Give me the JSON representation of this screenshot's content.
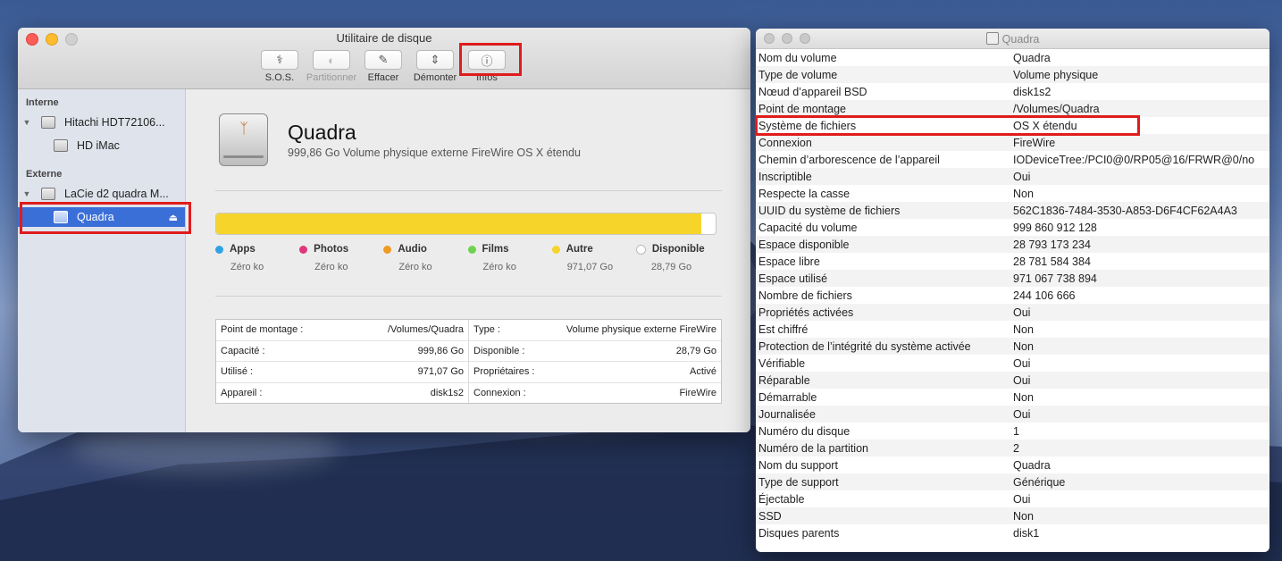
{
  "colors": {
    "bar_autre": "#f6d42a",
    "selection": "#3b6fd8",
    "highlight": "#e01c1c"
  },
  "du": {
    "title": "Utilitaire de disque",
    "toolbar": [
      {
        "label": "S.O.S.",
        "icon": "stethoscope-icon",
        "enabled": true
      },
      {
        "label": "Partitionner",
        "icon": "partition-icon",
        "enabled": false
      },
      {
        "label": "Effacer",
        "icon": "erase-icon",
        "enabled": true
      },
      {
        "label": "Démonter",
        "icon": "unmount-icon",
        "enabled": true
      },
      {
        "label": "Infos",
        "icon": "info-icon",
        "enabled": true
      }
    ],
    "sidebar": {
      "internal_label": "Interne",
      "external_label": "Externe",
      "items": [
        {
          "label": "Hitachi HDT72106..."
        },
        {
          "label": "HD iMac"
        },
        {
          "label": "LaCie d2 quadra M..."
        },
        {
          "label": "Quadra"
        }
      ]
    },
    "volume": {
      "name": "Quadra",
      "description": "999,86 Go Volume physique externe FireWire OS X étendu",
      "usage_fraction": 0.971
    },
    "legend": [
      {
        "label": "Apps",
        "value": "Zéro ko",
        "color": "#2fa3e6"
      },
      {
        "label": "Photos",
        "value": "Zéro ko",
        "color": "#e2367a"
      },
      {
        "label": "Audio",
        "value": "Zéro ko",
        "color": "#ef9a22"
      },
      {
        "label": "Films",
        "value": "Zéro ko",
        "color": "#6fd24f"
      },
      {
        "label": "Autre",
        "value": "971,07 Go",
        "color": "#f6d42a"
      },
      {
        "label": "Disponible",
        "value": "28,79 Go",
        "color": "#ffffff"
      }
    ],
    "props_left": [
      {
        "k": "Point de montage :",
        "v": "/Volumes/Quadra"
      },
      {
        "k": "Capacité :",
        "v": "999,86 Go"
      },
      {
        "k": "Utilisé :",
        "v": "971,07 Go"
      },
      {
        "k": "Appareil :",
        "v": "disk1s2"
      }
    ],
    "props_right": [
      {
        "k": "Type :",
        "v": "Volume physique externe FireWire"
      },
      {
        "k": "Disponible :",
        "v": "28,79 Go"
      },
      {
        "k": "Propriétaires :",
        "v": "Activé"
      },
      {
        "k": "Connexion :",
        "v": "FireWire"
      }
    ]
  },
  "info": {
    "title": "Quadra",
    "rows": [
      {
        "k": "Nom du volume",
        "v": "Quadra"
      },
      {
        "k": "Type de volume",
        "v": "Volume physique"
      },
      {
        "k": "Nœud d’appareil BSD",
        "v": "disk1s2"
      },
      {
        "k": "Point de montage",
        "v": "/Volumes/Quadra"
      },
      {
        "k": "Système de fichiers",
        "v": "OS X étendu"
      },
      {
        "k": "Connexion",
        "v": "FireWire"
      },
      {
        "k": "Chemin d’arborescence de l’appareil",
        "v": "IODeviceTree:/PCI0@0/RP05@16/FRWR@0/no"
      },
      {
        "k": "Inscriptible",
        "v": "Oui"
      },
      {
        "k": "Respecte la casse",
        "v": "Non"
      },
      {
        "k": "UUID du système de fichiers",
        "v": "562C1836-7484-3530-A853-D6F4CF62A4A3"
      },
      {
        "k": "Capacité du volume",
        "v": "999 860 912 128"
      },
      {
        "k": "Espace disponible",
        "v": "28 793 173 234"
      },
      {
        "k": "Espace libre",
        "v": "28 781 584 384"
      },
      {
        "k": "Espace utilisé",
        "v": "971 067 738 894"
      },
      {
        "k": "Nombre de fichiers",
        "v": "244 106 666"
      },
      {
        "k": "Propriétés activées",
        "v": "Oui"
      },
      {
        "k": "Est chiffré",
        "v": "Non"
      },
      {
        "k": "Protection de l’intégrité du système activée",
        "v": "Non"
      },
      {
        "k": "Vérifiable",
        "v": "Oui"
      },
      {
        "k": "Réparable",
        "v": "Oui"
      },
      {
        "k": "Démarrable",
        "v": "Non"
      },
      {
        "k": "Journalisée",
        "v": "Oui"
      },
      {
        "k": "Numéro du disque",
        "v": "1"
      },
      {
        "k": "Numéro de la partition",
        "v": "2"
      },
      {
        "k": "Nom du support",
        "v": "Quadra"
      },
      {
        "k": "Type de support",
        "v": "Générique"
      },
      {
        "k": "Éjectable",
        "v": "Oui"
      },
      {
        "k": "SSD",
        "v": "Non"
      },
      {
        "k": "Disques parents",
        "v": "disk1"
      }
    ]
  }
}
